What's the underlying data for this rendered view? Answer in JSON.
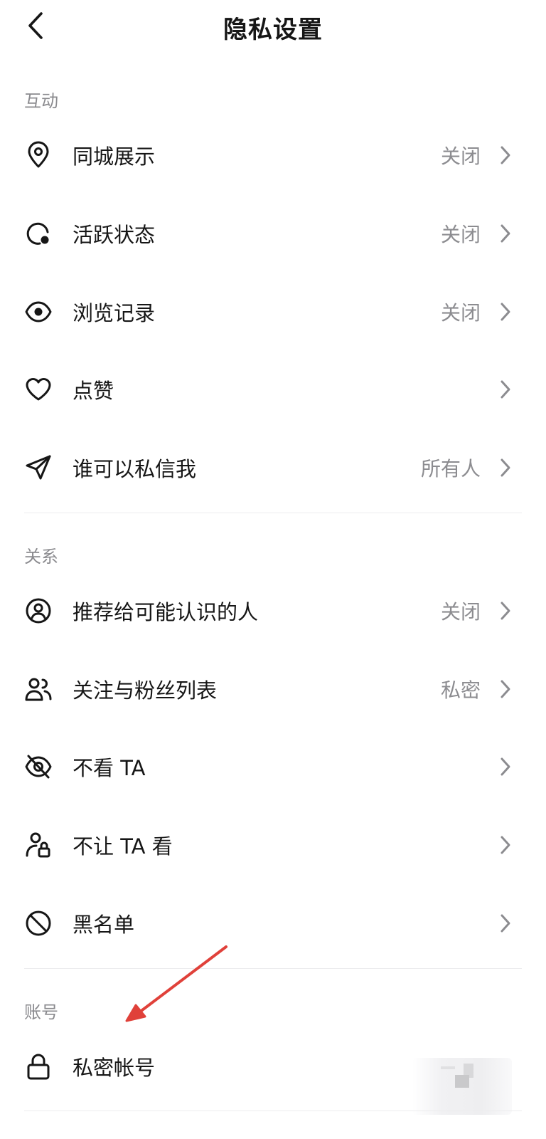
{
  "header": {
    "title": "隐私设置"
  },
  "sections": [
    {
      "label": "互动",
      "rows": [
        {
          "icon": "location-pin-icon",
          "label": "同城展示",
          "value": "关闭"
        },
        {
          "icon": "active-status-icon",
          "label": "活跃状态",
          "value": "关闭"
        },
        {
          "icon": "eye-icon",
          "label": "浏览记录",
          "value": "关闭"
        },
        {
          "icon": "heart-icon",
          "label": "点赞",
          "value": ""
        },
        {
          "icon": "send-icon",
          "label": "谁可以私信我",
          "value": "所有人"
        }
      ]
    },
    {
      "label": "关系",
      "rows": [
        {
          "icon": "user-circle-icon",
          "label": "推荐给可能认识的人",
          "value": "关闭"
        },
        {
          "icon": "users-icon",
          "label": "关注与粉丝列表",
          "value": "私密"
        },
        {
          "icon": "eye-off-icon",
          "label": "不看 TA",
          "value": ""
        },
        {
          "icon": "user-lock-icon",
          "label": "不让 TA 看",
          "value": ""
        },
        {
          "icon": "block-icon",
          "label": "黑名单",
          "value": ""
        }
      ]
    },
    {
      "label": "账号",
      "rows": [
        {
          "icon": "lock-icon",
          "label": "私密帐号",
          "value": ""
        }
      ]
    }
  ],
  "colors": {
    "text": "#161616",
    "secondary": "#8c8c90",
    "divider": "#ececee",
    "annotation": "#e0413a"
  }
}
